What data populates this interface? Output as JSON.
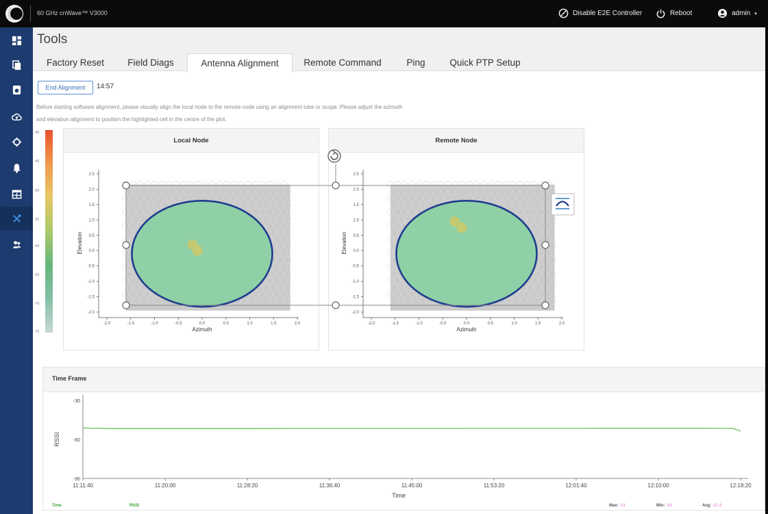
{
  "topbar": {
    "product_name": "60 GHz cnWave™ V3000",
    "disable_e2e_label": "Disable E2E Controller",
    "reboot_label": "Reboot",
    "user_label": "admin"
  },
  "sidebar": {
    "items": [
      {
        "icon": "dashboard-icon"
      },
      {
        "icon": "copy-icon"
      },
      {
        "icon": "device-icon"
      },
      {
        "icon": "cloud-icon"
      },
      {
        "icon": "target-icon"
      },
      {
        "icon": "bell-icon"
      },
      {
        "icon": "calendar-icon"
      },
      {
        "icon": "tools-icon",
        "active": true
      },
      {
        "icon": "people-icon"
      }
    ]
  },
  "page": {
    "title": "Tools",
    "tabs": [
      {
        "label": "Factory Reset"
      },
      {
        "label": "Field Diags"
      },
      {
        "label": "Antenna Alignment",
        "active": true
      },
      {
        "label": "Remote Command"
      },
      {
        "label": "Ping"
      },
      {
        "label": "Quick PTP Setup"
      }
    ]
  },
  "alignment": {
    "end_button_label": "End Alignment",
    "timer": "14:57",
    "instruction_line1": "Before starting software alignment, please visually align the local node to the remote node using an alignment tube or scope. Please adjust the azimuth",
    "instruction_line2": "and elevation alignment to position the highlighted cell in the centre of the plot.",
    "colorbar_labels": [
      "-40",
      "-45",
      "-50",
      "-55",
      "-60",
      "-65",
      "-70",
      "-75"
    ]
  },
  "plots": {
    "local_title": "Local Node",
    "remote_title": "Remote Node",
    "xlabel": "Azimuth",
    "ylabel": "Elevation",
    "x_ticks": [
      "-2.0",
      "-1.5",
      "-1.0",
      "-0.5",
      "0.0",
      "0.5",
      "1.0",
      "1.5",
      "2.0"
    ],
    "y_ticks": [
      "2.5",
      "2.0",
      "1.5",
      "1.0",
      "0.5",
      "0.0",
      "-0.5",
      "-1.0",
      "-1.5",
      "-2.0"
    ],
    "colors": {
      "fill": "#8fd0a6",
      "ring": "#1e3d8f",
      "grey": "#c9c9c9",
      "highlight": "#c9c96b"
    }
  },
  "timeframe": {
    "title": "Time Frame",
    "stats": {
      "time_label": "Time",
      "rssi_label": "RSSI",
      "max_label": "Max:",
      "max_value": "-51",
      "min_label": "Min:",
      "min_value": "-54",
      "avg_label": "Avg:",
      "avg_value": "-51.8"
    }
  },
  "chart_data": {
    "type": "line",
    "xlabel": "Time",
    "ylabel": "RSSI",
    "ylim": [
      -90,
      -30
    ],
    "y_ticks": [
      "-30",
      "-60",
      "-90"
    ],
    "x_ticks": [
      "11:11:40",
      "11:20:00",
      "11:28:20",
      "11:36:40",
      "11:45:00",
      "11:53:20",
      "12:01:40",
      "12:10:00",
      "12:18:20"
    ],
    "series": [
      {
        "name": "RSSI",
        "color": "#6cbf5c",
        "x": [
          "11:11:40",
          "11:11:55",
          "11:12:10",
          "11:12:30",
          "11:13:00",
          "11:14:00",
          "11:20:00",
          "11:28:20",
          "11:36:40",
          "11:45:00",
          "11:53:20",
          "12:01:40",
          "12:10:00",
          "12:17:30",
          "12:18:10",
          "12:18:20"
        ],
        "values": [
          -51,
          -51.5,
          -51,
          -51.6,
          -51.3,
          -51.7,
          -51.7,
          -51.7,
          -51.6,
          -51.6,
          -51.5,
          -51.5,
          -51.4,
          -51.5,
          -53,
          -54
        ]
      }
    ]
  }
}
